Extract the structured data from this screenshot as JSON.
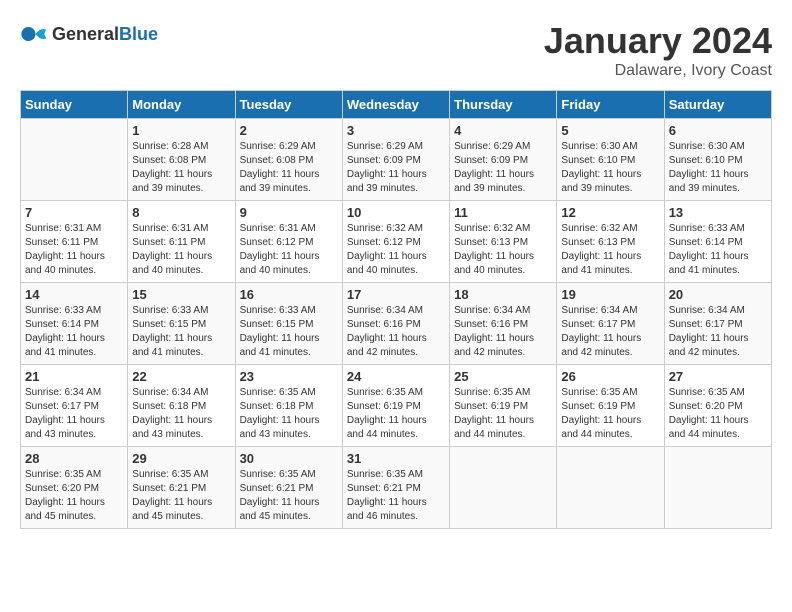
{
  "logo": {
    "general": "General",
    "blue": "Blue"
  },
  "header": {
    "month": "January 2024",
    "location": "Dalaware, Ivory Coast"
  },
  "days_of_week": [
    "Sunday",
    "Monday",
    "Tuesday",
    "Wednesday",
    "Thursday",
    "Friday",
    "Saturday"
  ],
  "weeks": [
    [
      {
        "day": "",
        "sunrise": "",
        "sunset": "",
        "daylight": ""
      },
      {
        "day": "1",
        "sunrise": "Sunrise: 6:28 AM",
        "sunset": "Sunset: 6:08 PM",
        "daylight": "Daylight: 11 hours and 39 minutes."
      },
      {
        "day": "2",
        "sunrise": "Sunrise: 6:29 AM",
        "sunset": "Sunset: 6:08 PM",
        "daylight": "Daylight: 11 hours and 39 minutes."
      },
      {
        "day": "3",
        "sunrise": "Sunrise: 6:29 AM",
        "sunset": "Sunset: 6:09 PM",
        "daylight": "Daylight: 11 hours and 39 minutes."
      },
      {
        "day": "4",
        "sunrise": "Sunrise: 6:29 AM",
        "sunset": "Sunset: 6:09 PM",
        "daylight": "Daylight: 11 hours and 39 minutes."
      },
      {
        "day": "5",
        "sunrise": "Sunrise: 6:30 AM",
        "sunset": "Sunset: 6:10 PM",
        "daylight": "Daylight: 11 hours and 39 minutes."
      },
      {
        "day": "6",
        "sunrise": "Sunrise: 6:30 AM",
        "sunset": "Sunset: 6:10 PM",
        "daylight": "Daylight: 11 hours and 39 minutes."
      }
    ],
    [
      {
        "day": "7",
        "sunrise": "Sunrise: 6:31 AM",
        "sunset": "Sunset: 6:11 PM",
        "daylight": "Daylight: 11 hours and 40 minutes."
      },
      {
        "day": "8",
        "sunrise": "Sunrise: 6:31 AM",
        "sunset": "Sunset: 6:11 PM",
        "daylight": "Daylight: 11 hours and 40 minutes."
      },
      {
        "day": "9",
        "sunrise": "Sunrise: 6:31 AM",
        "sunset": "Sunset: 6:12 PM",
        "daylight": "Daylight: 11 hours and 40 minutes."
      },
      {
        "day": "10",
        "sunrise": "Sunrise: 6:32 AM",
        "sunset": "Sunset: 6:12 PM",
        "daylight": "Daylight: 11 hours and 40 minutes."
      },
      {
        "day": "11",
        "sunrise": "Sunrise: 6:32 AM",
        "sunset": "Sunset: 6:13 PM",
        "daylight": "Daylight: 11 hours and 40 minutes."
      },
      {
        "day": "12",
        "sunrise": "Sunrise: 6:32 AM",
        "sunset": "Sunset: 6:13 PM",
        "daylight": "Daylight: 11 hours and 41 minutes."
      },
      {
        "day": "13",
        "sunrise": "Sunrise: 6:33 AM",
        "sunset": "Sunset: 6:14 PM",
        "daylight": "Daylight: 11 hours and 41 minutes."
      }
    ],
    [
      {
        "day": "14",
        "sunrise": "Sunrise: 6:33 AM",
        "sunset": "Sunset: 6:14 PM",
        "daylight": "Daylight: 11 hours and 41 minutes."
      },
      {
        "day": "15",
        "sunrise": "Sunrise: 6:33 AM",
        "sunset": "Sunset: 6:15 PM",
        "daylight": "Daylight: 11 hours and 41 minutes."
      },
      {
        "day": "16",
        "sunrise": "Sunrise: 6:33 AM",
        "sunset": "Sunset: 6:15 PM",
        "daylight": "Daylight: 11 hours and 41 minutes."
      },
      {
        "day": "17",
        "sunrise": "Sunrise: 6:34 AM",
        "sunset": "Sunset: 6:16 PM",
        "daylight": "Daylight: 11 hours and 42 minutes."
      },
      {
        "day": "18",
        "sunrise": "Sunrise: 6:34 AM",
        "sunset": "Sunset: 6:16 PM",
        "daylight": "Daylight: 11 hours and 42 minutes."
      },
      {
        "day": "19",
        "sunrise": "Sunrise: 6:34 AM",
        "sunset": "Sunset: 6:17 PM",
        "daylight": "Daylight: 11 hours and 42 minutes."
      },
      {
        "day": "20",
        "sunrise": "Sunrise: 6:34 AM",
        "sunset": "Sunset: 6:17 PM",
        "daylight": "Daylight: 11 hours and 42 minutes."
      }
    ],
    [
      {
        "day": "21",
        "sunrise": "Sunrise: 6:34 AM",
        "sunset": "Sunset: 6:17 PM",
        "daylight": "Daylight: 11 hours and 43 minutes."
      },
      {
        "day": "22",
        "sunrise": "Sunrise: 6:34 AM",
        "sunset": "Sunset: 6:18 PM",
        "daylight": "Daylight: 11 hours and 43 minutes."
      },
      {
        "day": "23",
        "sunrise": "Sunrise: 6:35 AM",
        "sunset": "Sunset: 6:18 PM",
        "daylight": "Daylight: 11 hours and 43 minutes."
      },
      {
        "day": "24",
        "sunrise": "Sunrise: 6:35 AM",
        "sunset": "Sunset: 6:19 PM",
        "daylight": "Daylight: 11 hours and 44 minutes."
      },
      {
        "day": "25",
        "sunrise": "Sunrise: 6:35 AM",
        "sunset": "Sunset: 6:19 PM",
        "daylight": "Daylight: 11 hours and 44 minutes."
      },
      {
        "day": "26",
        "sunrise": "Sunrise: 6:35 AM",
        "sunset": "Sunset: 6:19 PM",
        "daylight": "Daylight: 11 hours and 44 minutes."
      },
      {
        "day": "27",
        "sunrise": "Sunrise: 6:35 AM",
        "sunset": "Sunset: 6:20 PM",
        "daylight": "Daylight: 11 hours and 44 minutes."
      }
    ],
    [
      {
        "day": "28",
        "sunrise": "Sunrise: 6:35 AM",
        "sunset": "Sunset: 6:20 PM",
        "daylight": "Daylight: 11 hours and 45 minutes."
      },
      {
        "day": "29",
        "sunrise": "Sunrise: 6:35 AM",
        "sunset": "Sunset: 6:21 PM",
        "daylight": "Daylight: 11 hours and 45 minutes."
      },
      {
        "day": "30",
        "sunrise": "Sunrise: 6:35 AM",
        "sunset": "Sunset: 6:21 PM",
        "daylight": "Daylight: 11 hours and 45 minutes."
      },
      {
        "day": "31",
        "sunrise": "Sunrise: 6:35 AM",
        "sunset": "Sunset: 6:21 PM",
        "daylight": "Daylight: 11 hours and 46 minutes."
      },
      {
        "day": "",
        "sunrise": "",
        "sunset": "",
        "daylight": ""
      },
      {
        "day": "",
        "sunrise": "",
        "sunset": "",
        "daylight": ""
      },
      {
        "day": "",
        "sunrise": "",
        "sunset": "",
        "daylight": ""
      }
    ]
  ]
}
